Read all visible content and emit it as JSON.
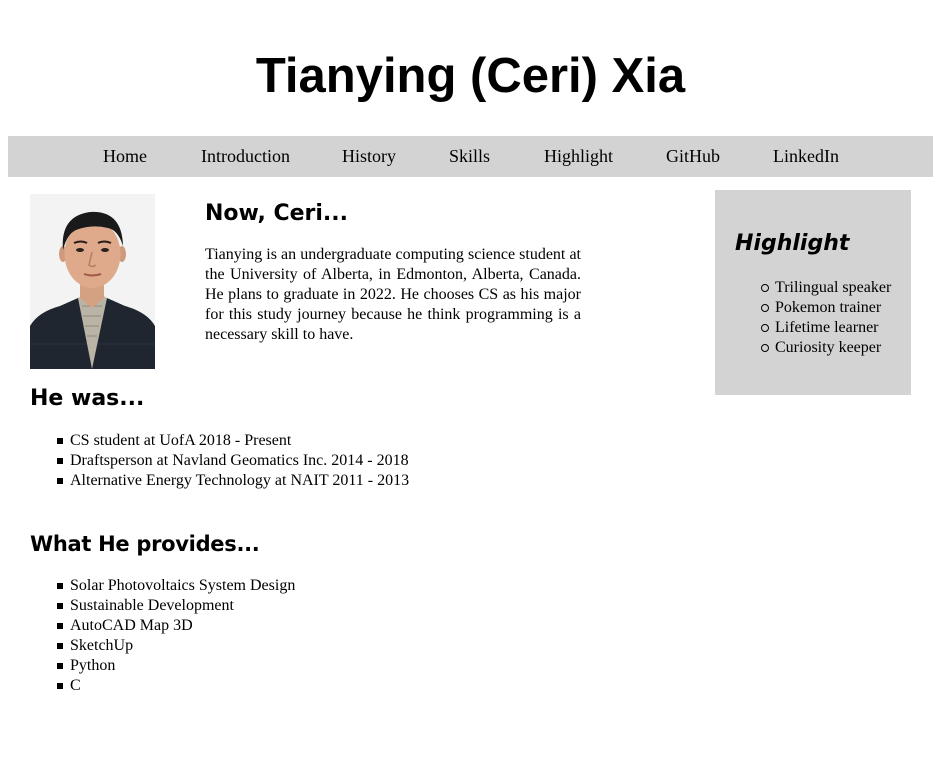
{
  "header": {
    "title": "Tianying (Ceri) Xia"
  },
  "nav": {
    "items": [
      "Home",
      "Introduction",
      "History",
      "Skills",
      "Highlight",
      "GitHub",
      "LinkedIn"
    ]
  },
  "intro": {
    "heading": "Now, Ceri...",
    "text": "Tianying is an undergraduate computing science student at the University of Alberta, in Edmonton, Alberta, Canada. He plans to graduate in 2022. He chooses CS as his major for this study journey because he think programming is a necessary skill to have."
  },
  "history": {
    "heading": "He was...",
    "items": [
      "CS student at UofA 2018 - Present",
      "Draftsperson at Navland Geomatics Inc. 2014 - 2018",
      "Alternative Energy Technology at NAIT 2011 - 2013"
    ]
  },
  "skills": {
    "heading": "What He provides...",
    "items": [
      "Solar Photovoltaics System Design",
      "Sustainable Development",
      "AutoCAD Map 3D",
      "SketchUp",
      "Python",
      "C"
    ]
  },
  "highlight": {
    "heading": "Highlight",
    "items": [
      "Trilingual speaker",
      "Pokemon trainer",
      "Lifetime learner",
      "Curiosity keeper"
    ]
  },
  "colors": {
    "nav_background": "#d3d3d3",
    "highlight_background": "#d3d3d3",
    "page_background": "#ffffff",
    "text": "#000000"
  }
}
